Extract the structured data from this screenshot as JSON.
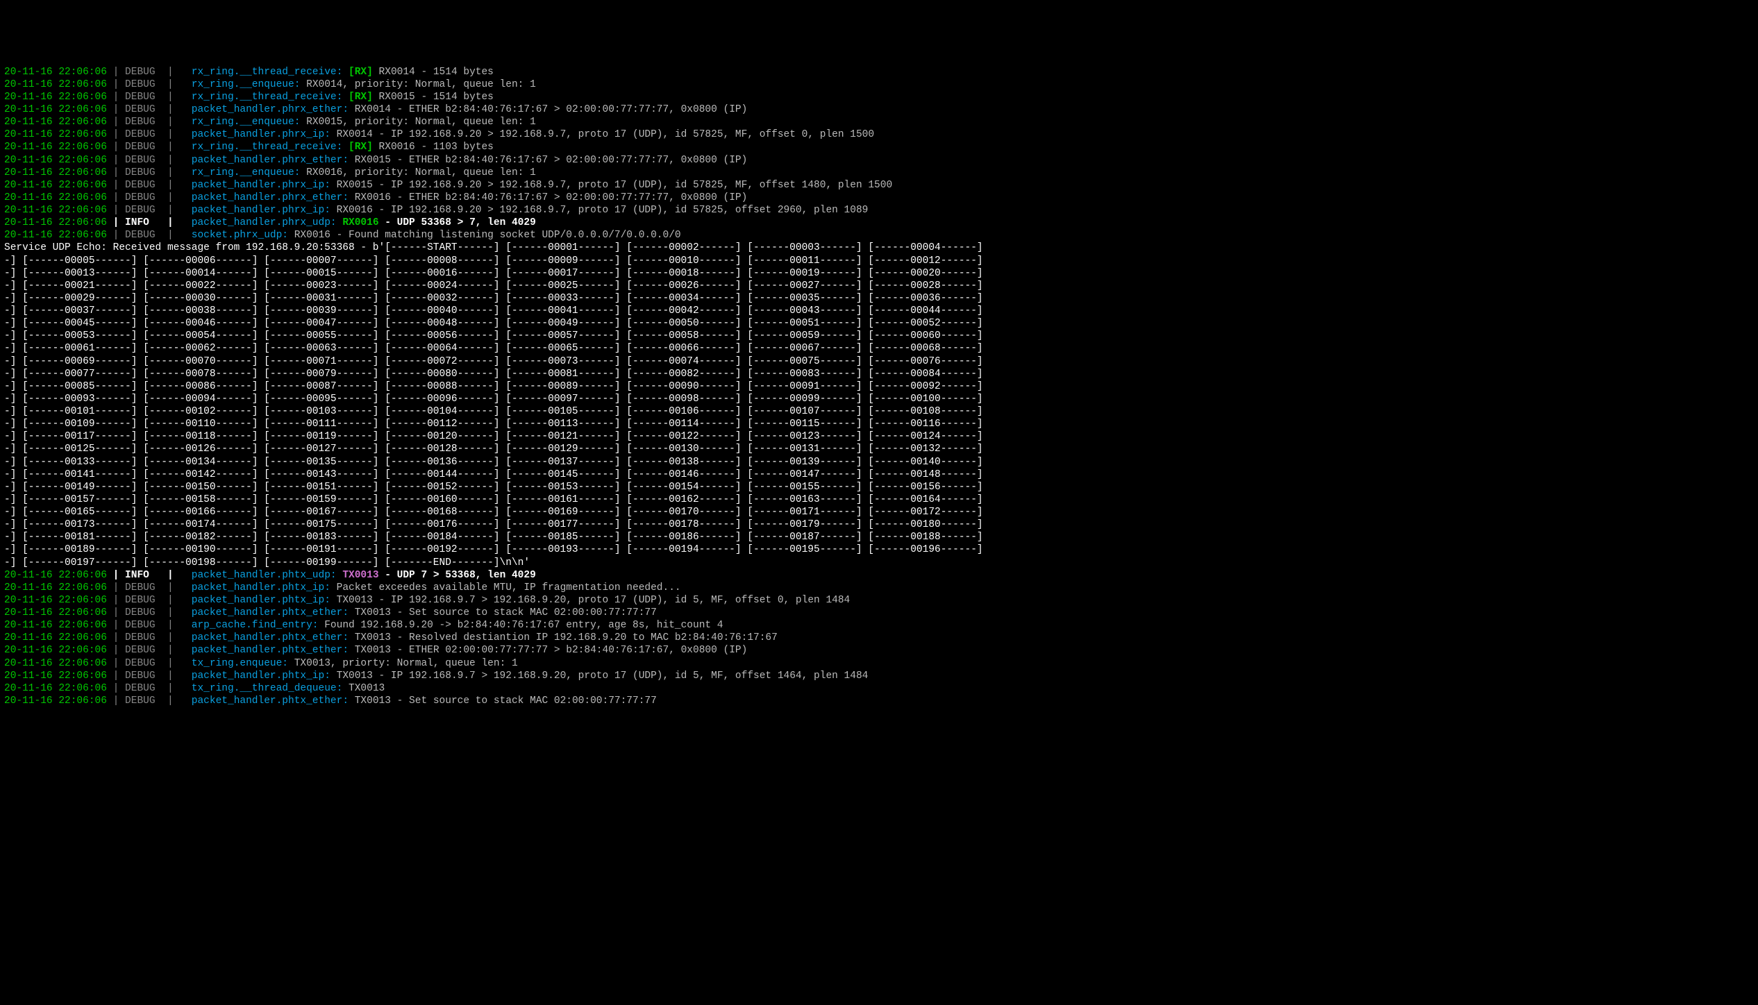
{
  "timestamp": "20-11-16 22:06:06",
  "levels": {
    "debug": "DEBUG",
    "info": "INFO "
  },
  "sep1": " | ",
  "sep2": "  | ",
  "sep2tight": " | ",
  "pre_lines": [
    {
      "lvl": "debug",
      "src": "rx_ring.__thread_receive:",
      "tag": "[RX]",
      "tagc": "rx",
      "rest": " RX0014 - 1514 bytes"
    },
    {
      "lvl": "debug",
      "src": "rx_ring.__enqueue:",
      "rest": " RX0014, priority: Normal, queue len: 1"
    },
    {
      "lvl": "debug",
      "src": "rx_ring.__thread_receive:",
      "tag": "[RX]",
      "tagc": "rx",
      "rest": " RX0015 - 1514 bytes"
    },
    {
      "lvl": "debug",
      "src": "packet_handler.phrx_ether:",
      "rest": " RX0014 - ETHER b2:84:40:76:17:67 > 02:00:00:77:77:77, 0x0800 (IP)"
    },
    {
      "lvl": "debug",
      "src": "rx_ring.__enqueue:",
      "rest": " RX0015, priority: Normal, queue len: 1"
    },
    {
      "lvl": "debug",
      "src": "packet_handler.phrx_ip:",
      "rest": " RX0014 - IP 192.168.9.20 > 192.168.9.7, proto 17 (UDP), id 57825, MF, offset 0, plen 1500"
    },
    {
      "lvl": "debug",
      "src": "rx_ring.__thread_receive:",
      "tag": "[RX]",
      "tagc": "rx",
      "rest": " RX0016 - 1103 bytes"
    },
    {
      "lvl": "debug",
      "src": "packet_handler.phrx_ether:",
      "rest": " RX0015 - ETHER b2:84:40:76:17:67 > 02:00:00:77:77:77, 0x0800 (IP)"
    },
    {
      "lvl": "debug",
      "src": "rx_ring.__enqueue:",
      "rest": " RX0016, priority: Normal, queue len: 1"
    },
    {
      "lvl": "debug",
      "src": "packet_handler.phrx_ip:",
      "rest": " RX0015 - IP 192.168.9.20 > 192.168.9.7, proto 17 (UDP), id 57825, MF, offset 1480, plen 1500"
    },
    {
      "lvl": "debug",
      "src": "packet_handler.phrx_ether:",
      "rest": " RX0016 - ETHER b2:84:40:76:17:67 > 02:00:00:77:77:77, 0x0800 (IP)"
    },
    {
      "lvl": "debug",
      "src": "packet_handler.phrx_ip:",
      "rest": " RX0016 - IP 192.168.9.20 > 192.168.9.7, proto 17 (UDP), id 57825, offset 2960, plen 1089"
    },
    {
      "lvl": "info",
      "src": "packet_handler.phrx_udp:",
      "tag": "RX0016",
      "tagc": "rx",
      "restHL": " - UDP 53368 > 7, len 4029"
    },
    {
      "lvl": "debug",
      "src": "socket.phrx_udp:",
      "rest": " RX0016 - Found matching listening socket UDP/0.0.0.0/7/0.0.0.0/0"
    }
  ],
  "echo_prefix": "Service UDP Echo: Received message from 192.168.9.20:53368 - b'",
  "payload": {
    "start": "[------START------]",
    "end": "[-------END-------]",
    "first": 1,
    "last": 199,
    "tail": "\\n\\n'"
  },
  "post_lines": [
    {
      "lvl": "info",
      "src": "packet_handler.phtx_udp:",
      "tag": "TX0013",
      "tagc": "tx",
      "restHL": " - UDP 7 > 53368, len 4029"
    },
    {
      "lvl": "debug",
      "src": "packet_handler.phtx_ip:",
      "rest": " Packet exceedes available MTU, IP fragmentation needed..."
    },
    {
      "lvl": "debug",
      "src": "packet_handler.phtx_ip:",
      "rest": " TX0013 - IP 192.168.9.7 > 192.168.9.20, proto 17 (UDP), id 5, MF, offset 0, plen 1484"
    },
    {
      "lvl": "debug",
      "src": "packet_handler.phtx_ether:",
      "rest": " TX0013 - Set source to stack MAC 02:00:00:77:77:77"
    },
    {
      "lvl": "debug",
      "src": "arp_cache.find_entry:",
      "rest": " Found 192.168.9.20 -> b2:84:40:76:17:67 entry, age 8s, hit_count 4"
    },
    {
      "lvl": "debug",
      "src": "packet_handler.phtx_ether:",
      "rest": " TX0013 - Resolved destiantion IP 192.168.9.20 to MAC b2:84:40:76:17:67"
    },
    {
      "lvl": "debug",
      "src": "packet_handler.phtx_ether:",
      "rest": " TX0013 - ETHER 02:00:00:77:77:77 > b2:84:40:76:17:67, 0x0800 (IP)"
    },
    {
      "lvl": "debug",
      "src": "tx_ring.enqueue:",
      "rest": " TX0013, priorty: Normal, queue len: 1"
    },
    {
      "lvl": "debug",
      "src": "packet_handler.phtx_ip:",
      "rest": " TX0013 - IP 192.168.9.7 > 192.168.9.20, proto 17 (UDP), id 5, MF, offset 1464, plen 1484"
    },
    {
      "lvl": "debug",
      "src": "tx_ring.__thread_dequeue:",
      "rest": " TX0013"
    },
    {
      "lvl": "debug",
      "src": "packet_handler.phtx_ether:",
      "rest": " TX0013 - Set source to stack MAC 02:00:00:77:77:77"
    }
  ]
}
